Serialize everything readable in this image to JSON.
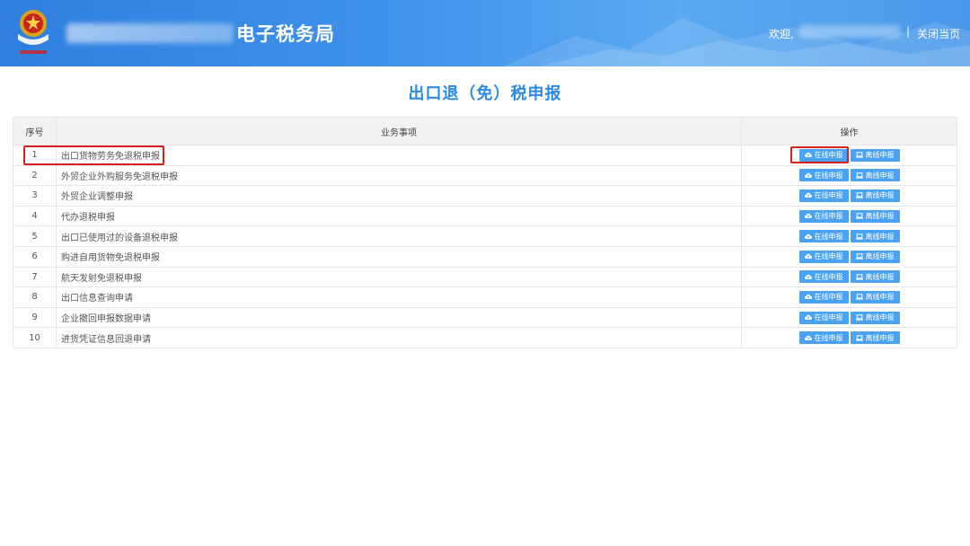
{
  "header": {
    "title": "电子税务局",
    "welcome": "欢迎,",
    "separator": "|",
    "close_page": "关闭当页"
  },
  "page": {
    "title": "出口退（免）税申报"
  },
  "table": {
    "columns": [
      "序号",
      "业务事项",
      "操作"
    ],
    "rows": [
      {
        "num": "1",
        "item": "出口货物劳务免退税申报"
      },
      {
        "num": "2",
        "item": "外贸企业外购服务免退税申报"
      },
      {
        "num": "3",
        "item": "外贸企业调整申报"
      },
      {
        "num": "4",
        "item": "代办退税申报"
      },
      {
        "num": "5",
        "item": "出口已使用过的设备退税申报"
      },
      {
        "num": "6",
        "item": "购进自用货物免退税申报"
      },
      {
        "num": "7",
        "item": "航天发射免退税申报"
      },
      {
        "num": "8",
        "item": "出口信息查询申请"
      },
      {
        "num": "9",
        "item": "企业撤回申报数据申请"
      },
      {
        "num": "10",
        "item": "进货凭证信息回退申请"
      }
    ],
    "online_label": "在线申报",
    "offline_label": "离线申报"
  },
  "colors": {
    "header_blue": "#3f92ea",
    "title_blue": "#2a8ae6",
    "button_blue": "#4aa3f2",
    "highlight_red": "#d62020"
  },
  "icons": {
    "online": "cloud-upload-icon",
    "offline": "laptop-icon",
    "emblem": "tax-emblem-icon"
  }
}
